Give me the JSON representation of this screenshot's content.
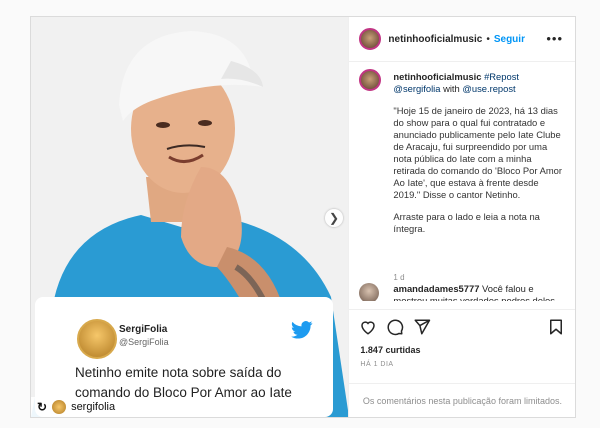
{
  "header": {
    "username": "netinhooficialmusic",
    "separator": "•",
    "follow_label": "Seguir",
    "more_icon": "more-horizontal-icon"
  },
  "caption": {
    "username": "netinhooficialmusic",
    "hashtag": "#Repost",
    "mention": "@sergifolia",
    "with_text": "with",
    "via": "@use.repost",
    "quote": "\"Hoje 15 de janeiro de 2023, há 13 dias do show para o qual fui contratado e anunciado publicamente pelo Iate Clube de Aracaju, fui surpreendido por uma nota pública do Iate com a minha retirada do comando do 'Bloco Por Amor Ao Iate', que estava à frente desde 2019.\" Disse o cantor Netinho.",
    "cta": "Arraste para o lado e leia a nota na íntegra.",
    "time": "1 d"
  },
  "comment": {
    "username": "amandadames5777",
    "text": "Você falou e mostrou muitas verdades podres deles"
  },
  "media": {
    "tweet_name": "SergiFolia",
    "tweet_handle": "@SergiFolia",
    "tweet_text": "Netinho emite nota sobre saída do comando do Bloco Por Amor ao Iate",
    "repost_user": "sergifolia"
  },
  "stats": {
    "likes": "1.847 curtidas",
    "ago": "HÁ 1 DIA"
  },
  "footer": {
    "limited_text": "Os comentários nesta publicação foram limitados."
  },
  "colors": {
    "accent": "#0095f6",
    "link": "#00376b",
    "shirt": "#2a9bd3",
    "twitter": "#1d9bf0"
  }
}
